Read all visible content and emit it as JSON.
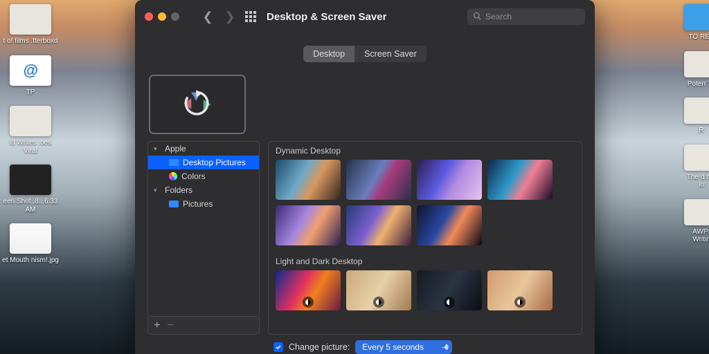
{
  "window": {
    "title": "Desktop & Screen Saver"
  },
  "search": {
    "placeholder": "Search"
  },
  "tabs": {
    "desktop": "Desktop",
    "screensaver": "Screen Saver"
  },
  "sidebar": {
    "groups": {
      "apple": "Apple",
      "folders": "Folders"
    },
    "items": {
      "desktopPictures": "Desktop Pictures",
      "colors": "Colors",
      "pictures": "Pictures"
    }
  },
  "gallery": {
    "section1": "Dynamic Desktop",
    "section2": "Light and Dark Desktop"
  },
  "options": {
    "changePictureLabel": "Change picture:",
    "interval": "Every 5 seconds"
  },
  "desktopIconsLeft": {
    "i0": "t of films\n.tterboxd",
    "i1": "TP",
    "i2": "ld Writes\n.oes Viral",
    "i3": "een Shot\n.8...6.33 AM",
    "i4": "et Mouth\nnism!.jpg"
  },
  "desktopIconsRight": {
    "i0": "TO REA",
    "i1": "Poten\nTh",
    "i2": "R",
    "i3": "The d\nthe lo",
    "i4": "AWP-\nWritin"
  }
}
